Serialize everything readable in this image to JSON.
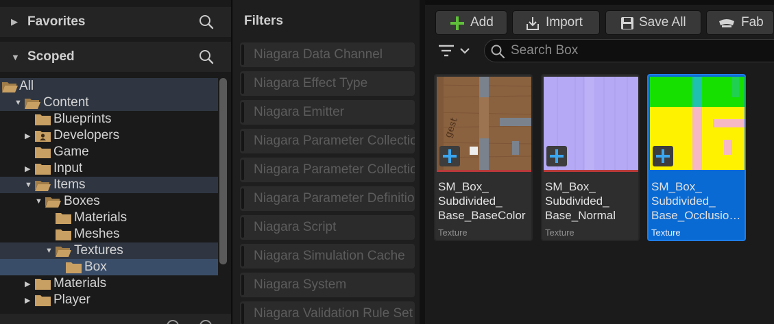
{
  "sources": {
    "favorites_label": "Favorites",
    "scoped_label": "Scoped",
    "tree": [
      {
        "label": "All",
        "depth": 0,
        "expanded": true,
        "has_children": true,
        "state": "dim",
        "icon": "folder-open-icon"
      },
      {
        "label": "Content",
        "depth": 1,
        "expanded": true,
        "has_children": true,
        "state": "dim",
        "icon": "folder-open-icon"
      },
      {
        "label": "Blueprints",
        "depth": 2,
        "expanded": false,
        "has_children": false,
        "state": "none",
        "icon": "folder-icon"
      },
      {
        "label": "Developers",
        "depth": 2,
        "expanded": false,
        "has_children": true,
        "state": "none",
        "icon": "folder-user-icon"
      },
      {
        "label": "Game",
        "depth": 2,
        "expanded": false,
        "has_children": false,
        "state": "none",
        "icon": "folder-icon"
      },
      {
        "label": "Input",
        "depth": 2,
        "expanded": false,
        "has_children": true,
        "state": "none",
        "icon": "folder-icon"
      },
      {
        "label": "Items",
        "depth": 2,
        "expanded": true,
        "has_children": true,
        "state": "dim",
        "icon": "folder-open-icon"
      },
      {
        "label": "Boxes",
        "depth": 3,
        "expanded": true,
        "has_children": true,
        "state": "none",
        "icon": "folder-open-icon"
      },
      {
        "label": "Materials",
        "depth": 4,
        "expanded": false,
        "has_children": false,
        "state": "none",
        "icon": "folder-icon"
      },
      {
        "label": "Meshes",
        "depth": 4,
        "expanded": false,
        "has_children": false,
        "state": "none",
        "icon": "folder-icon"
      },
      {
        "label": "Textures",
        "depth": 4,
        "expanded": true,
        "has_children": true,
        "state": "dim",
        "icon": "folder-open-icon"
      },
      {
        "label": "Box",
        "depth": 5,
        "expanded": false,
        "has_children": false,
        "state": "bright",
        "icon": "folder-icon"
      },
      {
        "label": "Materials",
        "depth": 2,
        "expanded": false,
        "has_children": true,
        "state": "none",
        "icon": "folder-icon"
      },
      {
        "label": "Player",
        "depth": 2,
        "expanded": false,
        "has_children": true,
        "state": "none",
        "icon": "folder-icon"
      }
    ]
  },
  "filters": {
    "title": "Filters",
    "items": [
      "Niagara Data Channel",
      "Niagara Effect Type",
      "Niagara Emitter",
      "Niagara Parameter Collection",
      "Niagara Parameter Collection Instance",
      "Niagara Parameter Definitions",
      "Niagara Script",
      "Niagara Simulation Cache",
      "Niagara System",
      "Niagara Validation Rule Set"
    ]
  },
  "toolbar": {
    "add_label": "Add",
    "import_label": "Import",
    "save_all_label": "Save All",
    "fab_label": "Fab"
  },
  "search": {
    "placeholder": "Search Box",
    "value": ""
  },
  "assets": [
    {
      "name_lines": [
        "SM_Box_",
        "Subdivided_",
        "Base_BaseColor"
      ],
      "type": "Texture",
      "selected": false,
      "thumbnail": "basecolor"
    },
    {
      "name_lines": [
        "SM_Box_",
        "Subdivided_",
        "Base_Normal"
      ],
      "type": "Texture",
      "selected": false,
      "thumbnail": "normal"
    },
    {
      "name_lines": [
        "SM_Box_",
        "Subdivided_",
        "Base_Occlusion..."
      ],
      "type": "Texture",
      "selected": true,
      "thumbnail": "occlusion"
    }
  ],
  "colors": {
    "selection_blue": "#0a6ad3",
    "tree_selected": "#3a4d68",
    "folder": "#c9a063",
    "add_green": "#5fbf3a",
    "plus_blue": "#3aa6f0",
    "texture_bar": "#b83a3a"
  }
}
